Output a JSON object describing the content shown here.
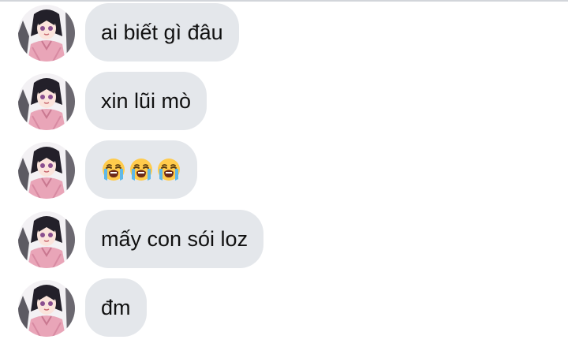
{
  "messages": [
    {
      "type": "text",
      "text": "ai biết gì đâu"
    },
    {
      "type": "text",
      "text": "xin lũi mò"
    },
    {
      "type": "emoji",
      "icons": [
        "loudly-crying-face",
        "loudly-crying-face",
        "loudly-crying-face"
      ]
    },
    {
      "type": "text",
      "text": "mấy con sói loz"
    },
    {
      "type": "text",
      "text": "đm"
    }
  ],
  "colors": {
    "bubble": "#e4e7eb",
    "text": "#111111",
    "divider": "#d2d5da"
  }
}
